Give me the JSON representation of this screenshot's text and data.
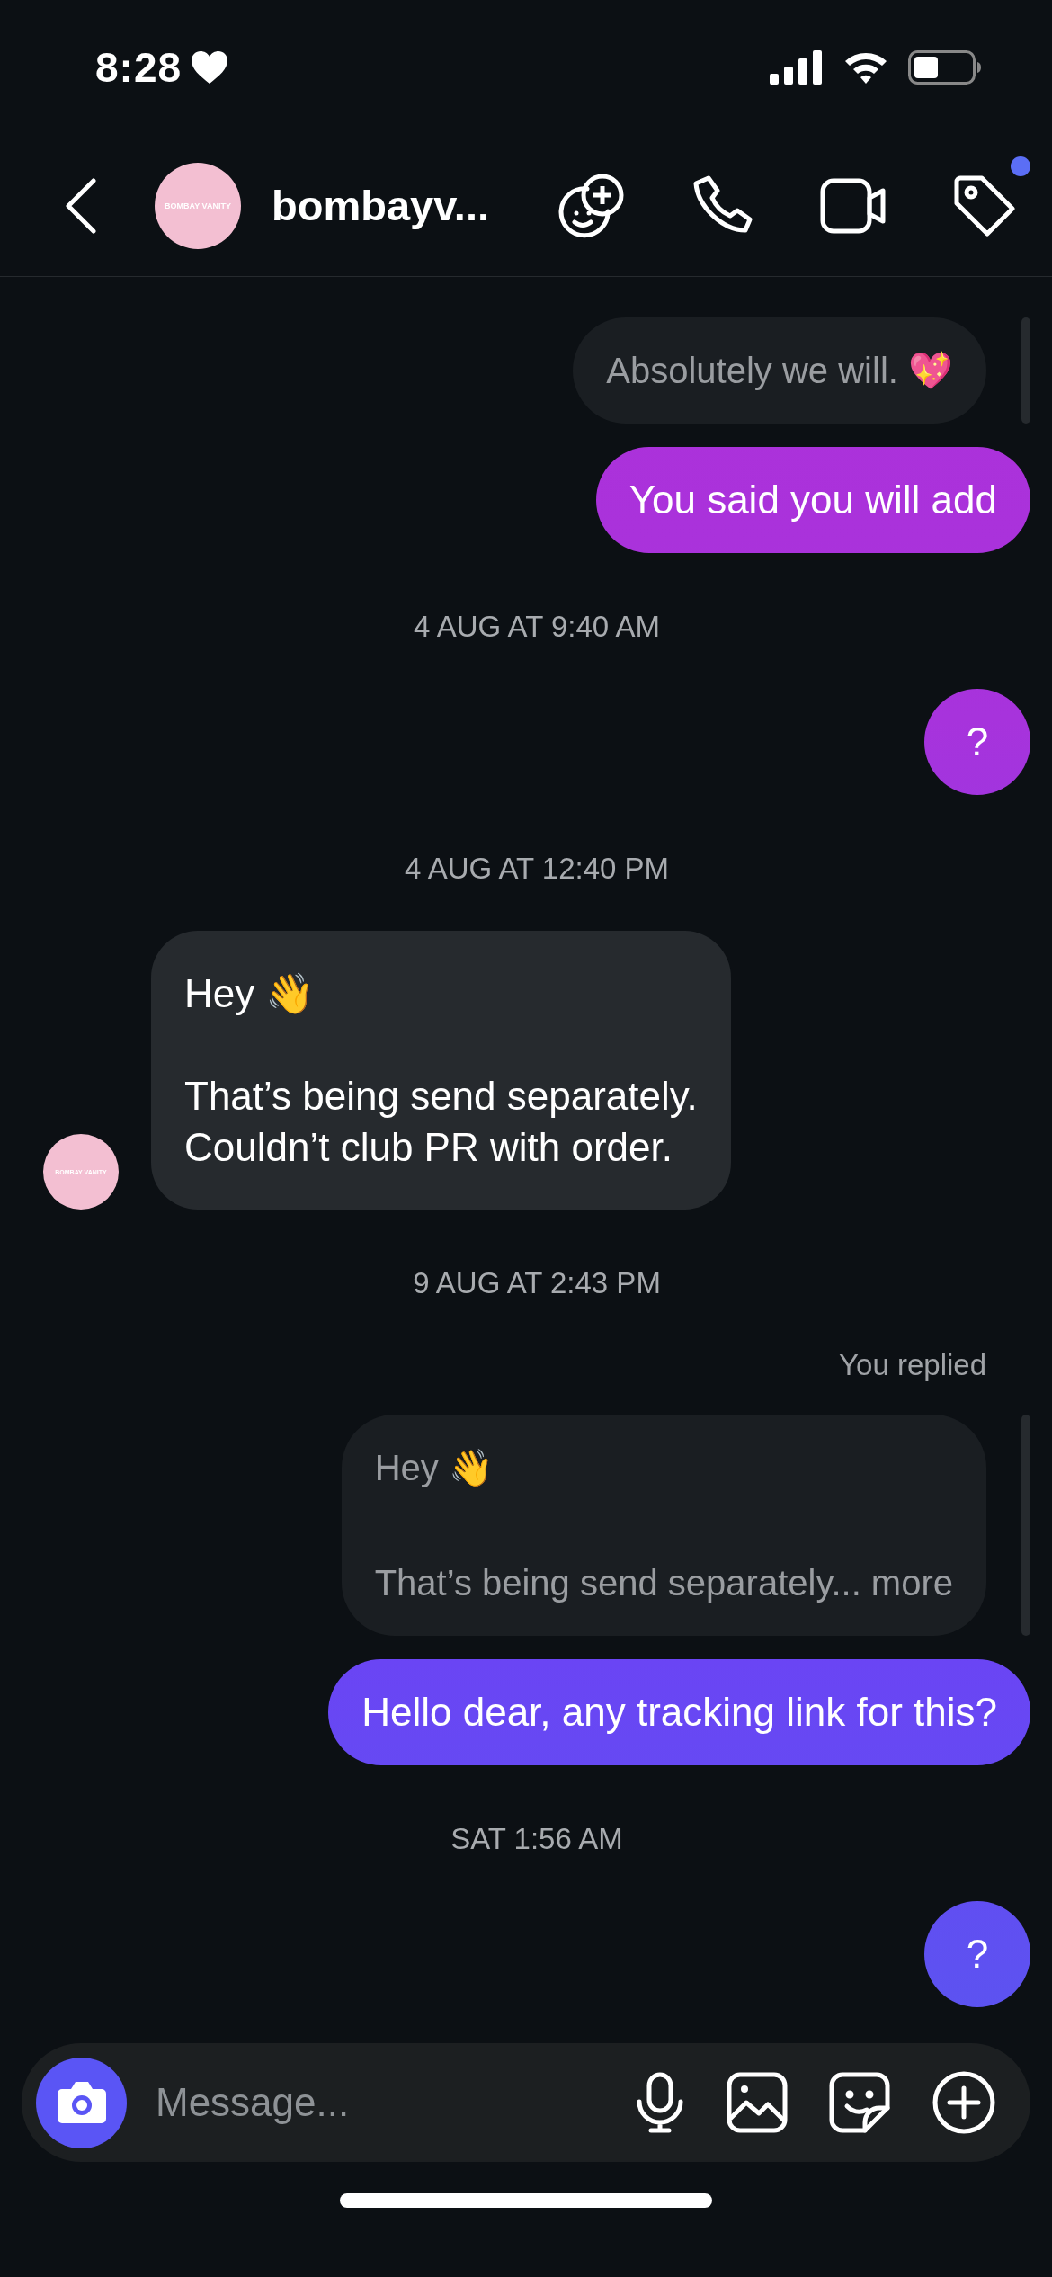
{
  "status_bar": {
    "time": "8:28"
  },
  "header": {
    "name": "bombayv...",
    "avatar_text": "BOMBAY VANITY",
    "tag_badge": true
  },
  "messages": [
    {
      "kind": "quoted",
      "text": "Absolutely we will. 💖"
    },
    {
      "kind": "sent",
      "text": "You said you will add"
    },
    {
      "kind": "timestamp",
      "text": "4 AUG AT 9:40 AM"
    },
    {
      "kind": "sent",
      "text": "?"
    },
    {
      "kind": "timestamp",
      "text": "4 AUG AT 12:40 PM"
    },
    {
      "kind": "received",
      "text": "Hey 👋\n\nThat’s being send separately.\nCouldn’t club PR with order.",
      "avatar_text": "BOMBAY VANITY"
    },
    {
      "kind": "timestamp",
      "text": "9 AUG AT 2:43 PM"
    },
    {
      "kind": "reply_label",
      "text": "You replied"
    },
    {
      "kind": "quoted",
      "text": "Hey 👋\n\nThat’s being send separately... more"
    },
    {
      "kind": "sent",
      "text": "Hello dear, any tracking link for this?"
    },
    {
      "kind": "timestamp",
      "text": "SAT 1:56 AM"
    },
    {
      "kind": "sent",
      "text": "?"
    }
  ],
  "composer": {
    "placeholder": "Message..."
  }
}
